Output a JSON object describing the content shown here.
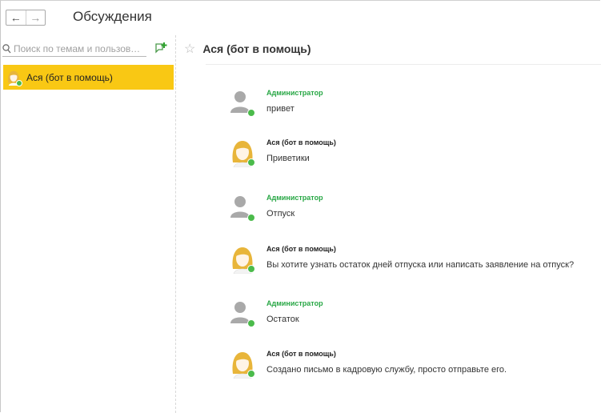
{
  "window": {
    "title": "Обсуждения"
  },
  "nav": {
    "back": "←",
    "forward": "→"
  },
  "sidebar": {
    "search_placeholder": "Поиск по темам и пользова...",
    "conversations": [
      {
        "label": "Ася (бот в помощь)"
      }
    ]
  },
  "chat": {
    "title": "Ася (бот в помощь)",
    "messages": [
      {
        "author": "Администратор",
        "text": "привет",
        "type": "admin"
      },
      {
        "author": "Ася (бот в помощь)",
        "text": "Приветики",
        "type": "bot"
      },
      {
        "author": "Администратор",
        "text": "Отпуск",
        "type": "admin"
      },
      {
        "author": "Ася (бот в помощь)",
        "text": "Вы хотите узнать остаток дней отпуска или написать заявление на отпуск?",
        "type": "bot"
      },
      {
        "author": "Администратор",
        "text": "Остаток",
        "type": "admin"
      },
      {
        "author": "Ася (бот в помощь)",
        "text": "Создано письмо в кадровую службу, просто отправьте его.",
        "type": "bot"
      }
    ]
  },
  "colors": {
    "accent_yellow": "#f9c814",
    "online_green": "#4bbb4b",
    "admin_name": "#28a745"
  }
}
